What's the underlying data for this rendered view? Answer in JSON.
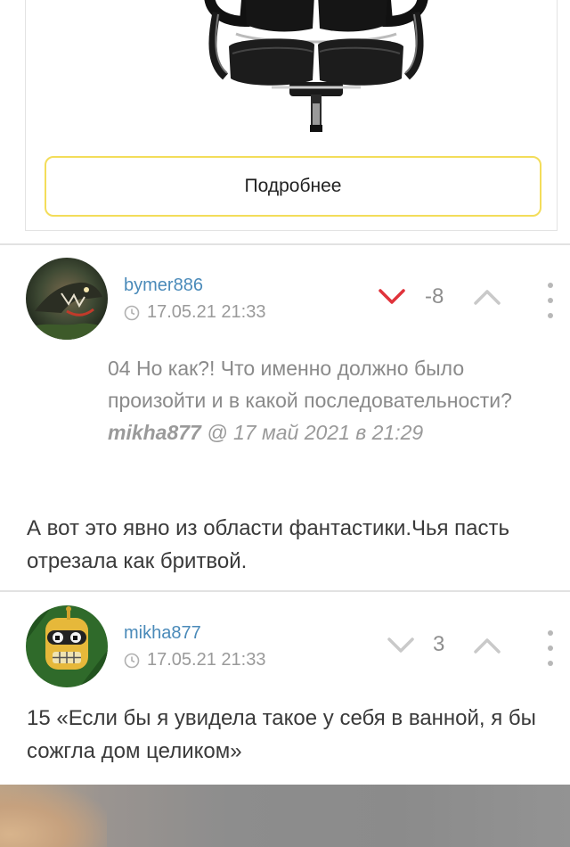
{
  "product": {
    "button_label": "Подробнее"
  },
  "comments": [
    {
      "username": "bymer886",
      "timestamp": "17.05.21 21:33",
      "rating": "-8",
      "vote_state": "down",
      "quote": {
        "text": "04 Но как?! Что именно должно было произойти и в какой последовательности?",
        "author": "mikha877",
        "ref": "@ 17 май 2021 в 21:29"
      },
      "text": "А вот это явно из области фантастики.Чья пасть отрезала как бритвой."
    },
    {
      "username": "mikha877",
      "timestamp": "17.05.21 21:33",
      "rating": "3",
      "vote_state": "none",
      "text": "15 «Если бы я увидела такое у себя в ванной, я бы сожгла дом целиком»"
    }
  ],
  "icons": {
    "clock": "clock-icon",
    "vote_down": "chevron-down-icon",
    "vote_up": "chevron-up-icon",
    "more": "more-vertical-icon"
  },
  "colors": {
    "accent_yellow": "#f3dd5a",
    "username_blue": "#4a8ab9",
    "downvote_active": "#e0333b",
    "muted": "#9a9a9a"
  }
}
